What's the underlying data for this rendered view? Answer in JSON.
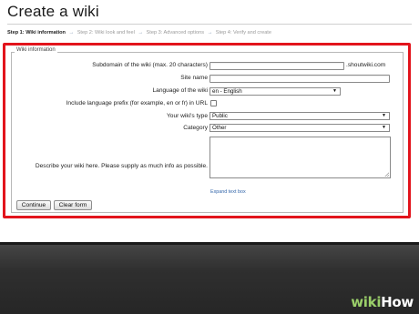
{
  "page": {
    "title": "Create a wiki"
  },
  "steps": {
    "step1": "Step 1: Wiki information",
    "arrow": "→",
    "step2": "Step 2: Wiki look and feel",
    "step3": "Step 3: Advanced options",
    "step4": "Step 4: Verify and create"
  },
  "form": {
    "legend": "Wiki information",
    "subdomain": {
      "label": "Subdomain of the wiki (max. 20 characters)",
      "value": "",
      "suffix": ".shoutwiki.com"
    },
    "site_name": {
      "label": "Site name",
      "value": ""
    },
    "language": {
      "label": "Language of the wiki",
      "value": "en - English"
    },
    "language_prefix": {
      "label": "Include language prefix (for example, en or fr) in URL",
      "checked": false
    },
    "wiki_type": {
      "label": "Your wiki's type",
      "value": "Public"
    },
    "category": {
      "label": "Category",
      "value": "Other"
    },
    "description": {
      "label": "Describe your wiki here. Please supply as much info as possible.",
      "value": ""
    },
    "expand_link": "Expand text box",
    "continue_label": "Continue",
    "clear_label": "Clear form"
  },
  "watermark": {
    "part1": "wiki",
    "part2": "How"
  },
  "colors": {
    "highlight": "#e2141c",
    "link": "#3366aa",
    "watermark_green": "#9bd06a"
  }
}
